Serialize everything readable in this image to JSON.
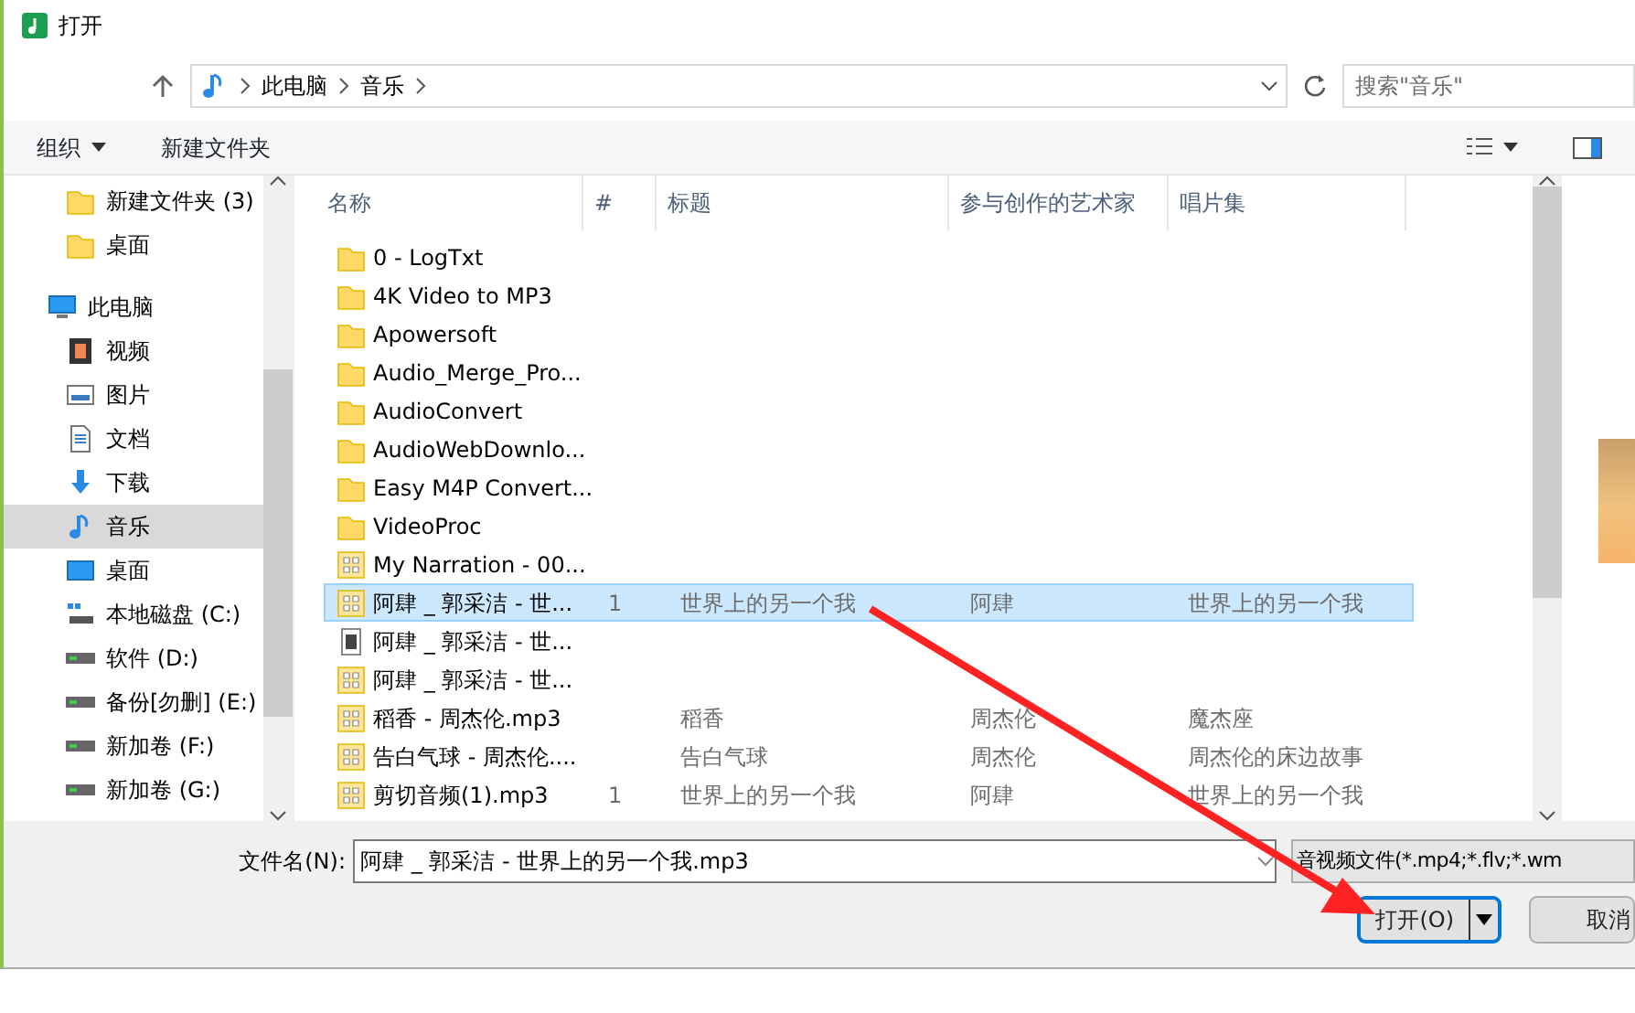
{
  "window": {
    "title": "打开"
  },
  "address": {
    "crumbs": [
      "此电脑",
      "音乐"
    ]
  },
  "search": {
    "placeholder": "搜索\"音乐\""
  },
  "toolbar": {
    "organize": "组织",
    "new_folder": "新建文件夹"
  },
  "sidebar": {
    "items": [
      {
        "label": "新建文件夹 (3)",
        "kind": "folder",
        "selected": false
      },
      {
        "label": "桌面",
        "kind": "folder",
        "selected": false
      },
      {
        "label": "此电脑",
        "kind": "pc",
        "selected": false,
        "children": [
          {
            "label": "视频",
            "kind": "video",
            "selected": false
          },
          {
            "label": "图片",
            "kind": "picture",
            "selected": false
          },
          {
            "label": "文档",
            "kind": "document",
            "selected": false
          },
          {
            "label": "下载",
            "kind": "download",
            "selected": false
          },
          {
            "label": "音乐",
            "kind": "music",
            "selected": true
          },
          {
            "label": "桌面",
            "kind": "desktop",
            "selected": false
          },
          {
            "label": "本地磁盘 (C:)",
            "kind": "system",
            "selected": false
          },
          {
            "label": "软件 (D:)",
            "kind": "drive",
            "selected": false
          },
          {
            "label": "备份[勿删] (E:)",
            "kind": "drive",
            "selected": false
          },
          {
            "label": "新加卷 (F:)",
            "kind": "drive",
            "selected": false
          },
          {
            "label": "新加卷 (G:)",
            "kind": "drive",
            "selected": false
          }
        ]
      }
    ]
  },
  "table": {
    "columns": [
      "名称",
      "#",
      "标题",
      "参与创作的艺术家",
      "唱片集"
    ],
    "rows": [
      {
        "kind": "folder",
        "selected": false,
        "cells": [
          "0 - LogTxt",
          "",
          "",
          "",
          ""
        ]
      },
      {
        "kind": "folder",
        "selected": false,
        "cells": [
          "4K Video to MP3",
          "",
          "",
          "",
          ""
        ]
      },
      {
        "kind": "folder",
        "selected": false,
        "cells": [
          "Apowersoft",
          "",
          "",
          "",
          ""
        ]
      },
      {
        "kind": "folder",
        "selected": false,
        "cells": [
          "Audio_Merge_Pro...",
          "",
          "",
          "",
          ""
        ]
      },
      {
        "kind": "folder",
        "selected": false,
        "cells": [
          "AudioConvert",
          "",
          "",
          "",
          ""
        ]
      },
      {
        "kind": "folder",
        "selected": false,
        "cells": [
          "AudioWebDownlo...",
          "",
          "",
          "",
          ""
        ]
      },
      {
        "kind": "folder",
        "selected": false,
        "cells": [
          "Easy M4P Convert...",
          "",
          "",
          "",
          ""
        ]
      },
      {
        "kind": "folder",
        "selected": false,
        "cells": [
          "VideoProc",
          "",
          "",
          "",
          ""
        ]
      },
      {
        "kind": "audio",
        "selected": false,
        "cells": [
          "My Narration - 00...",
          "",
          "",
          "",
          ""
        ]
      },
      {
        "kind": "audio",
        "selected": true,
        "cells": [
          "阿肆 _ 郭采洁 - 世...",
          "1",
          "世界上的另一个我",
          "阿肆",
          "世界上的另一个我"
        ]
      },
      {
        "kind": "video",
        "selected": false,
        "cells": [
          "阿肆 _ 郭采洁 - 世...",
          "",
          "",
          "",
          ""
        ]
      },
      {
        "kind": "audio",
        "selected": false,
        "cells": [
          "阿肆 _ 郭采洁 - 世...",
          "",
          "",
          "",
          ""
        ]
      },
      {
        "kind": "audio",
        "selected": false,
        "cells": [
          "稻香 - 周杰伦.mp3",
          "",
          "稻香",
          "周杰伦",
          "魔杰座"
        ]
      },
      {
        "kind": "audio",
        "selected": false,
        "cells": [
          "告白气球 - 周杰伦....",
          "",
          "告白气球",
          "周杰伦",
          "周杰伦的床边故事"
        ]
      },
      {
        "kind": "audio",
        "selected": false,
        "cells": [
          "剪切音频(1).mp3",
          "1",
          "世界上的另一个我",
          "阿肆",
          "世界上的另一个我"
        ]
      }
    ]
  },
  "footer": {
    "filename_label": "文件名(N):",
    "filename": "阿肆 _ 郭采洁 - 世界上的另一个我.mp3",
    "filter": "音视频文件(*.mp4;*.flv;*.wm",
    "open": "打开(O)",
    "cancel": "取消"
  }
}
